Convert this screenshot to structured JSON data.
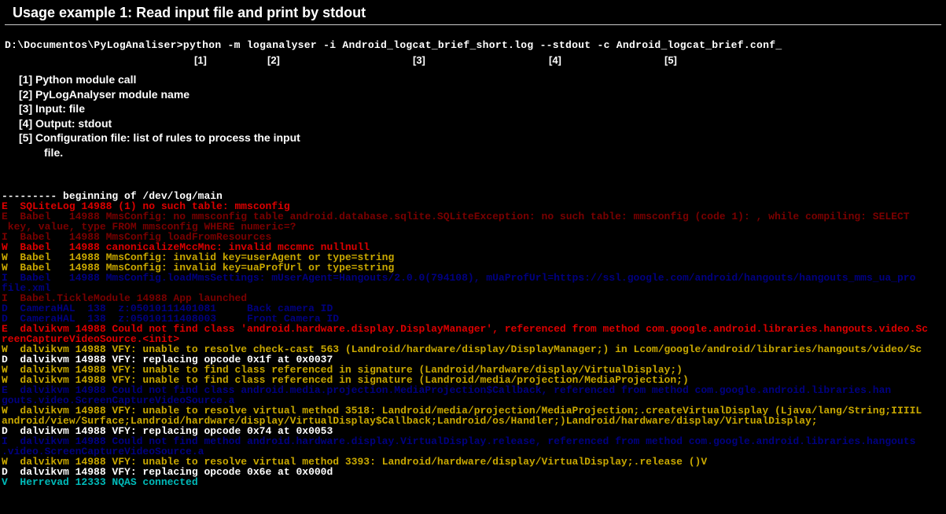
{
  "title": "Usage example 1: Read input file and print by stdout",
  "cmd": {
    "prompt": "D:\\Documentos\\PyLogAnaliser>",
    "p1": "python -m",
    "p2": "loganalyser",
    "p3": "-i Android_logcat_brief_short.log",
    "p4": "--stdout",
    "p5": "-c Android_logcat_brief.conf_"
  },
  "markers": {
    "m1": "[1]",
    "m2": "[2]",
    "m3": "[3]",
    "m4": "[4]",
    "m5": "[5]"
  },
  "legend": {
    "l1": "[1] Python module call",
    "l2": "[2] PyLogAnalyser module name",
    "l3": "[3] Input: file",
    "l4": "[4] Output: stdout",
    "l5": "[5] Configuration file: list of rules to process the input",
    "l5b": "file."
  },
  "log": [
    {
      "cls": "c-w",
      "t": "--------- beginning of /dev/log/main"
    },
    {
      "cls": "c-r",
      "t": "E  SQLiteLog 14988 (1) no such table: mmsconfig"
    },
    {
      "cls": "c-dr",
      "t": "E  Babel   14988 MmsConfig: no mmsconfig table android.database.sqlite.SQLiteException: no such table: mmsconfig (code 1): , while compiling: SELECT"
    },
    {
      "cls": "c-dr",
      "t": " key, value, type FROM mmsconfig WHERE numeric=?"
    },
    {
      "cls": "c-dr",
      "t": "I  Babel   14988 MmsConfig loadFromResources"
    },
    {
      "cls": "c-r",
      "t": "W  Babel   14988 canonicalizeMccMnc: invalid mccmnc nullnull"
    },
    {
      "cls": "c-y",
      "t": "W  Babel   14988 MmsConfig: invalid key=userAgent or type=string"
    },
    {
      "cls": "c-y",
      "t": "W  Babel   14988 MmsConfig: invalid key=uaProfUrl or type=string"
    },
    {
      "cls": "c-db",
      "t": "I  Babel   14988 MmsConfig.loadMmsSettings: mUserAgent=Hangouts/2.0.0(794108), mUaProfUrl=https://ssl.google.com/android/hangouts/hangouts_mms_ua_pro"
    },
    {
      "cls": "c-db",
      "t": "file.xml"
    },
    {
      "cls": "c-dr",
      "t": "I  Babel.TickleModule 14988 App launched"
    },
    {
      "cls": "c-db",
      "t": "D  CameraHAL  138  z:05010111401081     Back camera ID"
    },
    {
      "cls": "c-db",
      "t": "D  CameraHAL  138  z:05010111408003     Front Camera ID"
    },
    {
      "cls": "c-r",
      "t": "E  dalvikvm 14988 Could not find class 'android.hardware.display.DisplayManager', referenced from method com.google.android.libraries.hangouts.video.Sc"
    },
    {
      "cls": "c-r",
      "t": "reenCaptureVideoSource.<init>"
    },
    {
      "cls": "c-y",
      "t": "W  dalvikvm 14988 VFY: unable to resolve check-cast 563 (Landroid/hardware/display/DisplayManager;) in Lcom/google/android/libraries/hangouts/video/Sc"
    },
    {
      "cls": "c-w",
      "t": "D  dalvikvm 14988 VFY: replacing opcode 0x1f at 0x0037"
    },
    {
      "cls": "c-y",
      "t": "W  dalvikvm 14988 VFY: unable to find class referenced in signature (Landroid/hardware/display/VirtualDisplay;)"
    },
    {
      "cls": "c-y",
      "t": "W  dalvikvm 14988 VFY: unable to find class referenced in signature (Landroid/media/projection/MediaProjection;)"
    },
    {
      "cls": "c-db",
      "t": "E  dalvikvm 14988 Could not find class android.media.projection.MediaProjection$Callback, referenced from method com.google.android.libraries.han"
    },
    {
      "cls": "c-db",
      "t": "gouts.video.ScreenCaptureVideoSource.a"
    },
    {
      "cls": "c-y",
      "t": "W  dalvikvm 14988 VFY: unable to resolve virtual method 3518: Landroid/media/projection/MediaProjection;.createVirtualDisplay (Ljava/lang/String;IIIIL"
    },
    {
      "cls": "c-y",
      "t": "android/view/Surface;Landroid/hardware/display/VirtualDisplay$Callback;Landroid/os/Handler;)Landroid/hardware/display/VirtualDisplay;"
    },
    {
      "cls": "c-w",
      "t": "D  dalvikvm 14988 VFY: replacing opcode 0x74 at 0x0053"
    },
    {
      "cls": "c-db",
      "t": "I  dalvikvm 14988 Could not find method android.hardware.display.VirtualDisplay.release, referenced from method com.google.android.libraries.hangouts"
    },
    {
      "cls": "c-db",
      "t": ".video.ScreenCaptureVideoSource.a"
    },
    {
      "cls": "c-y",
      "t": "W  dalvikvm 14988 VFY: unable to resolve virtual method 3393: Landroid/hardware/display/VirtualDisplay;.release ()V"
    },
    {
      "cls": "c-w",
      "t": "D  dalvikvm 14988 VFY: replacing opcode 0x6e at 0x000d"
    },
    {
      "cls": "c-cy",
      "t": "V  Herrevad 12333 NQAS connected"
    }
  ]
}
